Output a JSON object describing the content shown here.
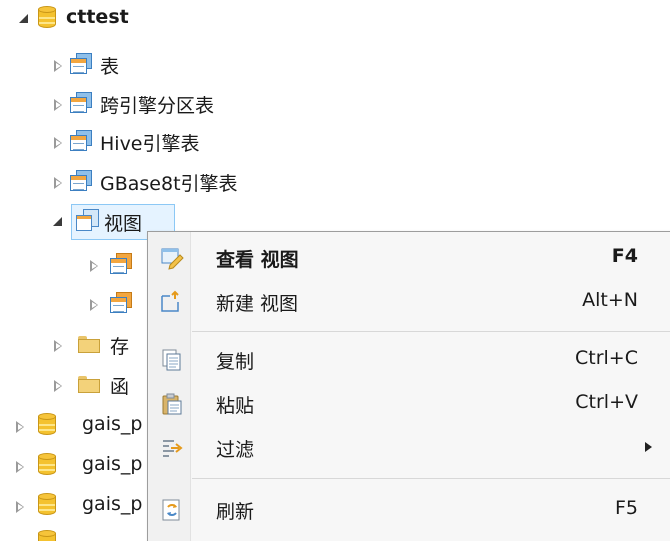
{
  "tree": {
    "root": {
      "label": "cttest",
      "expanded": true,
      "icon": "database-icon"
    },
    "children": [
      {
        "label": "表",
        "icon": "table-folder-icon",
        "expanded": false
      },
      {
        "label": "跨引擎分区表",
        "icon": "table-folder-icon",
        "expanded": false
      },
      {
        "label": "Hive引擎表",
        "icon": "table-folder-icon",
        "expanded": false
      },
      {
        "label": "GBase8t引擎表",
        "icon": "table-folder-icon",
        "expanded": false
      },
      {
        "label": "视图",
        "icon": "view-folder-icon",
        "expanded": true,
        "selected": true
      },
      {
        "label": "存",
        "icon": "folder-icon",
        "expanded": false
      },
      {
        "label": "函",
        "icon": "folder-icon",
        "expanded": false
      }
    ],
    "databases": [
      {
        "label": "gais_p"
      },
      {
        "label": "gais_p"
      },
      {
        "label": "gais_p"
      }
    ]
  },
  "context_menu": {
    "items": [
      {
        "label": "查看 视图",
        "shortcut": "F4",
        "bold": true,
        "icon": "edit-view-icon"
      },
      {
        "label": "新建 视图",
        "shortcut": "Alt+N",
        "icon": "new-view-icon"
      },
      {
        "label": "复制",
        "shortcut": "Ctrl+C",
        "icon": "copy-icon"
      },
      {
        "label": "粘贴",
        "shortcut": "Ctrl+V",
        "icon": "paste-icon"
      },
      {
        "label": "过滤",
        "shortcut": "",
        "submenu": true,
        "icon": "filter-icon"
      },
      {
        "label": "刷新",
        "shortcut": "F5",
        "icon": "refresh-icon"
      }
    ]
  },
  "colors": {
    "selection_bg": "#e5f3ff",
    "selection_border": "#8cc8f5",
    "menu_bg": "#f7f7f7",
    "database_yellow": "#f4c22f",
    "table_blue": "#3c7fc1"
  }
}
